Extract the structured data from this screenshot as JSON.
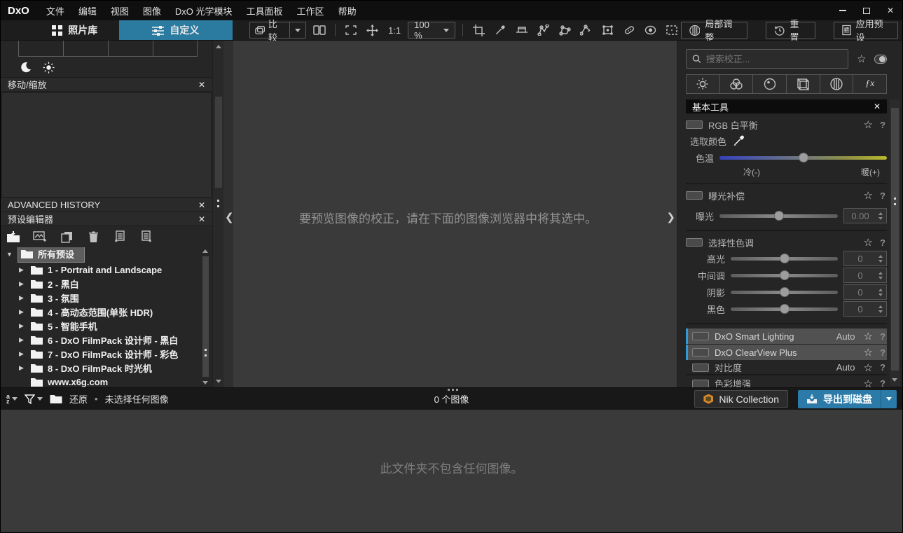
{
  "window": {
    "logo_text": "DxO",
    "menu": [
      "文件",
      "编辑",
      "视图",
      "图像",
      "DxO 光学模块",
      "工具面板",
      "工作区",
      "帮助"
    ],
    "controls": {
      "close": "✕"
    }
  },
  "tabs": {
    "photo_library": "照片库",
    "customize": "自定义"
  },
  "toolbar": {
    "compare": "比较",
    "ratio_label": "1:1",
    "zoom_level": "100 %",
    "local_adjustments": "局部调整",
    "reset": "重置",
    "apply_preset": "应用预设"
  },
  "left_panel": {
    "move_zoom_title": "移动/缩放",
    "advanced_history_title": "ADVANCED HISTORY",
    "preset_editor_title": "预设编辑器",
    "tree": [
      {
        "label": "所有预设"
      },
      {
        "label": "1 - Portrait and Landscape"
      },
      {
        "label": "2 - 黑白"
      },
      {
        "label": "3 - 氛围"
      },
      {
        "label": "4 - 高动态范围(单张 HDR)"
      },
      {
        "label": "5 - 智能手机"
      },
      {
        "label": "6 - DxO FilmPack 设计师 - 黑白"
      },
      {
        "label": "7 - DxO FilmPack 设计师 - 彩色"
      },
      {
        "label": "8 - DxO FilmPack 时光机"
      },
      {
        "label": "www.x6g.com"
      }
    ]
  },
  "canvas": {
    "message": "要预览图像的校正，请在下面的图像浏览器中将其选中。"
  },
  "right_panel": {
    "search_placeholder": "搜索校正...",
    "basic_tools_title": "基本工具",
    "rgb_white_balance": {
      "title": "RGB 白平衡",
      "pick_color_label": "选取颜色",
      "temperature_label": "色温",
      "cold_label": "冷(-)",
      "warm_label": "暖(+)"
    },
    "exposure_compensation": {
      "title": "曝光补偿",
      "exposure_label": "曝光",
      "value": "0.00"
    },
    "selective_tone": {
      "title": "选择性色调",
      "rows": [
        {
          "label": "高光",
          "value": "0"
        },
        {
          "label": "中间调",
          "value": "0"
        },
        {
          "label": "阴影",
          "value": "0"
        },
        {
          "label": "黑色",
          "value": "0"
        }
      ]
    },
    "smart_lighting": {
      "title": "DxO Smart Lighting",
      "mode": "Auto"
    },
    "clearview": {
      "title": "DxO ClearView Plus"
    },
    "contrast": {
      "title": "对比度",
      "mode": "Auto"
    },
    "color_rendering": {
      "title": "色彩增强"
    }
  },
  "filmstrip": {
    "restore_label": "还原",
    "bullet": "•",
    "selection_status": "未选择任何图像",
    "image_count": "0 个图像",
    "nik_collection_label": "Nik Collection",
    "export_label": "导出到磁盘",
    "empty_message": "此文件夹不包含任何图像。"
  },
  "icons": {
    "star": "☆",
    "help": "?",
    "close": "✕",
    "tree_expanded": "▼",
    "tree_collapsed": "▶",
    "chevron_left": "❮",
    "chevron_right": "❯",
    "sort_a": "a",
    "sort_z": "z"
  },
  "colors": {
    "accent_blue": "#2b7ba0",
    "export_blue": "#2b7aa8",
    "section_accent": "#2f9bd8",
    "nik_orange": "#d98a2b"
  }
}
